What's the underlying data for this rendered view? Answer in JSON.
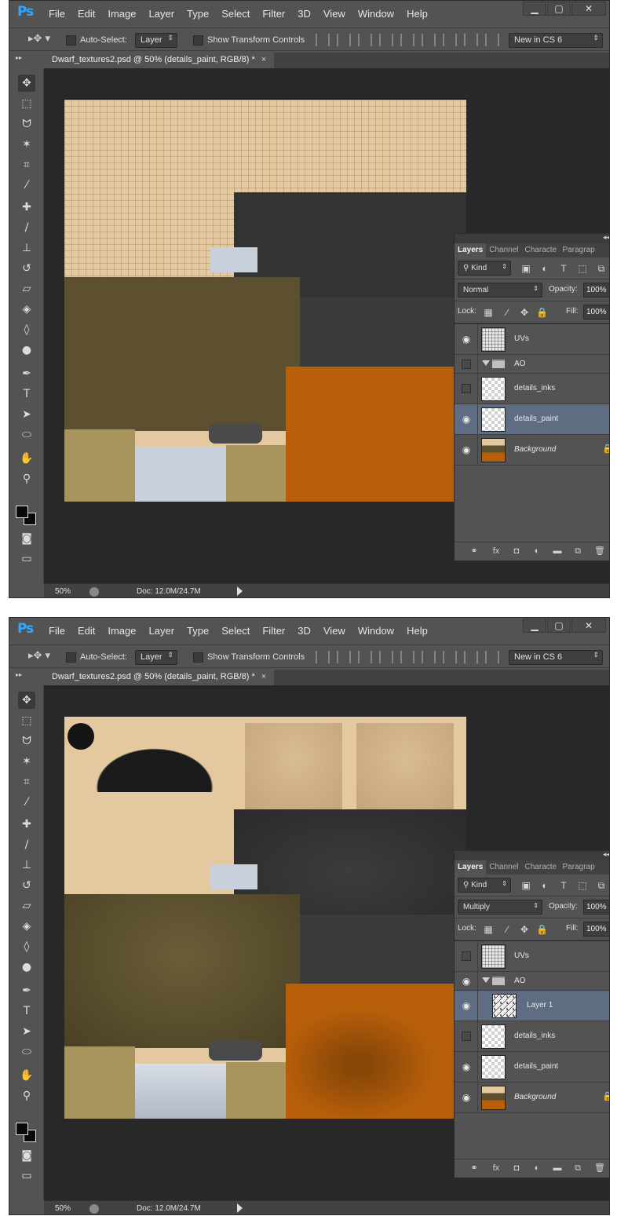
{
  "app": {
    "logo": "Ps",
    "menu": [
      "File",
      "Edit",
      "Image",
      "Layer",
      "Type",
      "Select",
      "Filter",
      "3D",
      "View",
      "Window",
      "Help"
    ],
    "window_controls": [
      "▁",
      "▢",
      "✕"
    ]
  },
  "options_bar": {
    "auto_select_label": "Auto-Select:",
    "auto_select_target": "Layer",
    "show_transform_label": "Show Transform Controls",
    "workspace": "New in CS 6"
  },
  "document_tab": {
    "title": "Dwarf_textures2.psd @ 50% (details_paint, RGB/8) *",
    "close": "×"
  },
  "status_bar": {
    "zoom": "50%",
    "doc_size": "Doc: 12.0M/24.7M"
  },
  "toolbar": {
    "tools": [
      "move-tool",
      "marquee-tool",
      "lasso-tool",
      "magic-wand-tool",
      "crop-tool",
      "eyedropper-tool",
      "healing-brush-tool",
      "brush-tool",
      "clone-stamp-tool",
      "history-brush-tool",
      "eraser-tool",
      "paint-bucket-tool",
      "blur-tool",
      "dodge-tool",
      "pen-tool",
      "type-tool",
      "path-selection-tool",
      "shape-tool",
      "hand-tool",
      "zoom-tool"
    ]
  },
  "panel": {
    "tabs": [
      "Layers",
      "Channel",
      "Characte",
      "Paragrap"
    ],
    "kind_label": "Kind",
    "opacity_label": "Opacity:",
    "fill_label": "Fill:",
    "lock_label": "Lock:",
    "collapse_icon": "◂◂",
    "close_icon": "✕",
    "menu_icon": "≡"
  },
  "screenshots": [
    {
      "blend_mode": "Normal",
      "opacity": "100%",
      "fill": "100%",
      "layers": [
        {
          "name": "UVs",
          "visible": true,
          "thumb": "uv"
        },
        {
          "name": "AO",
          "visible": false,
          "group": true
        },
        {
          "name": "details_inks",
          "visible": false,
          "thumb": "transparent"
        },
        {
          "name": "details_paint",
          "visible": true,
          "thumb": "transparent",
          "selected": true
        },
        {
          "name": "Background",
          "visible": true,
          "thumb": "bg",
          "locked": true,
          "italic": true
        }
      ]
    },
    {
      "blend_mode": "Multiply",
      "opacity": "100%",
      "fill": "100%",
      "layers": [
        {
          "name": "UVs",
          "visible": false,
          "thumb": "uv"
        },
        {
          "name": "AO",
          "visible": true,
          "group": true
        },
        {
          "name": "Layer 1",
          "visible": true,
          "thumb": "paint",
          "selected": true,
          "indent": true
        },
        {
          "name": "details_inks",
          "visible": false,
          "thumb": "transparent"
        },
        {
          "name": "details_paint",
          "visible": true,
          "thumb": "transparent"
        },
        {
          "name": "Background",
          "visible": true,
          "thumb": "bg",
          "locked": true,
          "italic": true
        }
      ]
    }
  ],
  "colors": {
    "ui_bg": "#535353",
    "canvas_bg": "#282828",
    "skin": "#e4c8a0",
    "dark_gray": "#323232",
    "olive": "#5c5030",
    "orange": "#b85f0a",
    "khaki": "#a8955e",
    "pale_blue": "#c8d0dc",
    "selection": "#5f6d82"
  }
}
